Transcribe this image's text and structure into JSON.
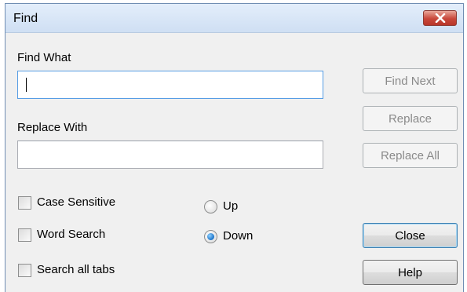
{
  "window": {
    "title": "Find"
  },
  "find": {
    "label": "Find What",
    "value": "",
    "placeholder": ""
  },
  "replace": {
    "label": "Replace With",
    "value": "",
    "placeholder": ""
  },
  "options": {
    "case_sensitive": {
      "label": "Case Sensitive",
      "checked": false
    },
    "word_search": {
      "label": "Word Search",
      "checked": false
    },
    "search_all_tabs": {
      "label": "Search all tabs",
      "checked": false
    }
  },
  "direction": {
    "up": {
      "label": "Up",
      "selected": false
    },
    "down": {
      "label": "Down",
      "selected": true
    }
  },
  "buttons": {
    "find_next": "Find Next",
    "replace": "Replace",
    "replace_all": "Replace All",
    "close": "Close",
    "help": "Help"
  },
  "icons": {
    "close": "close-icon"
  },
  "colors": {
    "close_button": "#c8473a",
    "focus_border": "#569de5",
    "radio_selected": "#1a73c9"
  }
}
